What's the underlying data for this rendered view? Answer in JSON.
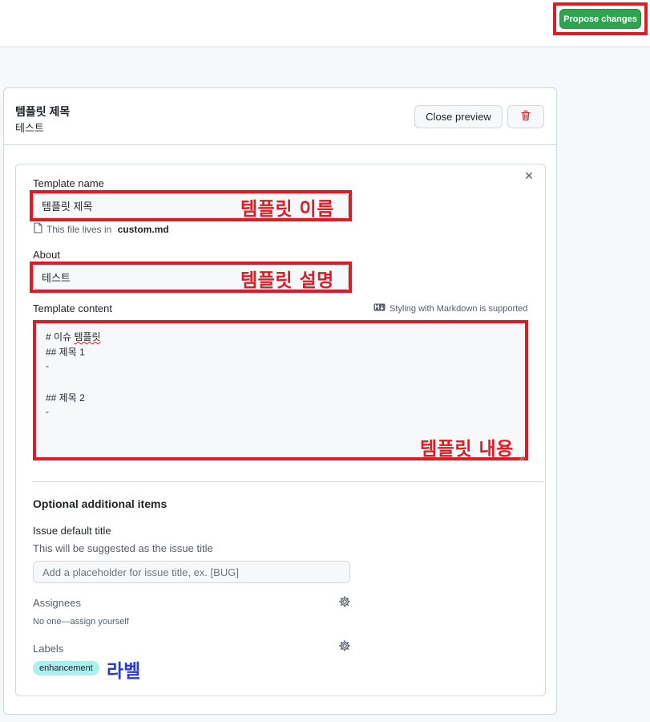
{
  "header": {
    "propose_label": "Propose changes"
  },
  "panel": {
    "title": "템플릿 제목",
    "subtitle": "테스트",
    "close_preview_label": "Close preview"
  },
  "form": {
    "template_name_label": "Template name",
    "template_name_value": "템플릿 제목",
    "file_note_prefix": "This file lives in ",
    "file_name": "custom.md",
    "about_label": "About",
    "about_value": "테스트",
    "content_label": "Template content",
    "markdown_note": "Styling with Markdown is supported",
    "content_lines": [
      "# 이슈 ",
      "템플릿",
      "## 제목 1",
      "-",
      "## 제목 2",
      "-"
    ],
    "optional_heading": "Optional additional items",
    "issue_title_label": "Issue default title",
    "issue_title_help": "This will be suggested as the issue title",
    "issue_title_placeholder": "Add a placeholder for issue title, ex. [BUG]",
    "assignees_label": "Assignees",
    "assignees_value": "No one—assign yourself",
    "labels_label": "Labels",
    "label_badge": "enhancement",
    "label_badge_color": "#a9f0ee"
  },
  "annotations": {
    "name": "템플릿 이름",
    "about": "템플릿 설명",
    "content": "템플릿 내용",
    "labels": "라벨",
    "highlight_color": "#e01b24",
    "label_annot_color": "#2b3dc8"
  },
  "icons": {
    "trash": "trash-icon",
    "close": "close-icon",
    "file": "file-icon",
    "markdown": "markdown-icon",
    "gear": "gear-icon"
  }
}
